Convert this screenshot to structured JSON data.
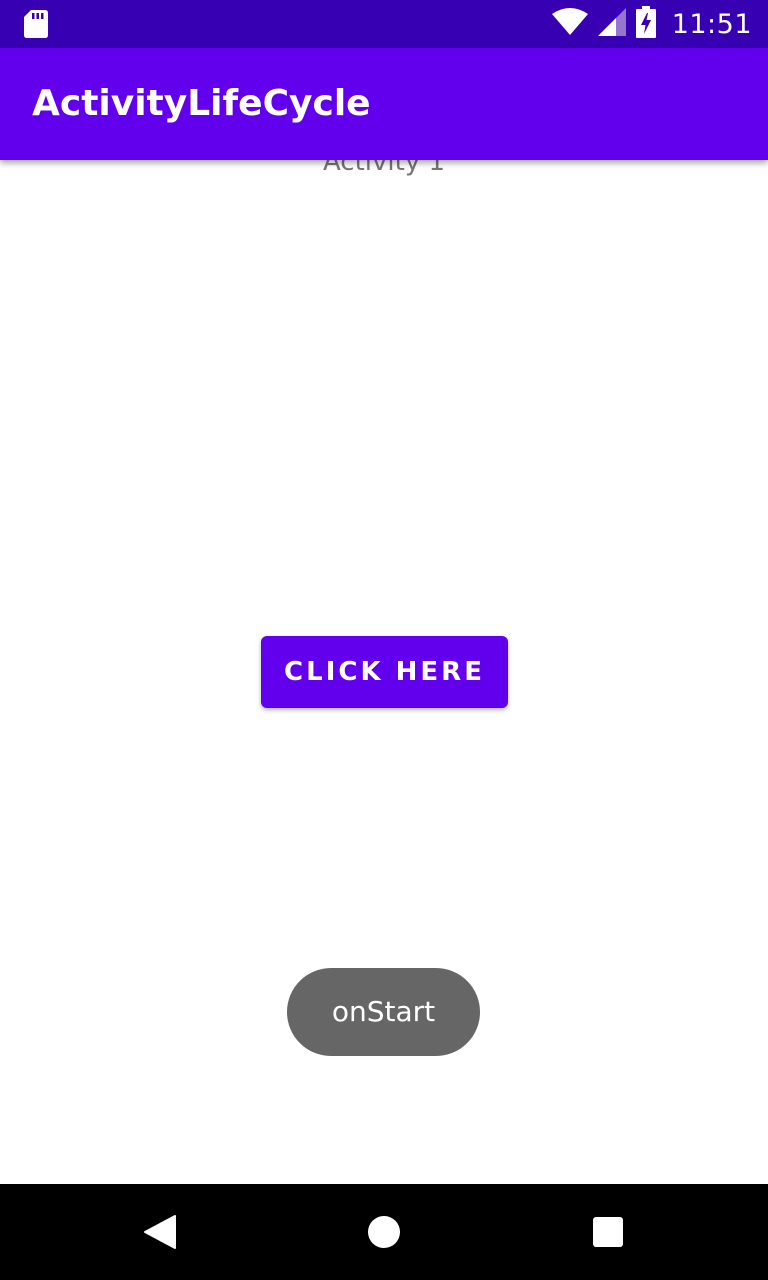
{
  "status_bar": {
    "time": "11:51",
    "icons": [
      "sd-card-icon",
      "wifi-icon",
      "signal-icon",
      "battery-charging-icon"
    ],
    "background_color": "#3700B3"
  },
  "app_bar": {
    "title": "ActivityLifeCycle",
    "background_color": "#6200EE"
  },
  "content": {
    "activity_label": "Activity 1",
    "button_label": "CLICK HERE",
    "button_color": "#6200EE"
  },
  "toast": {
    "message": "onStart"
  },
  "nav_bar": {
    "buttons": [
      "back-icon",
      "home-icon",
      "recents-icon"
    ]
  }
}
